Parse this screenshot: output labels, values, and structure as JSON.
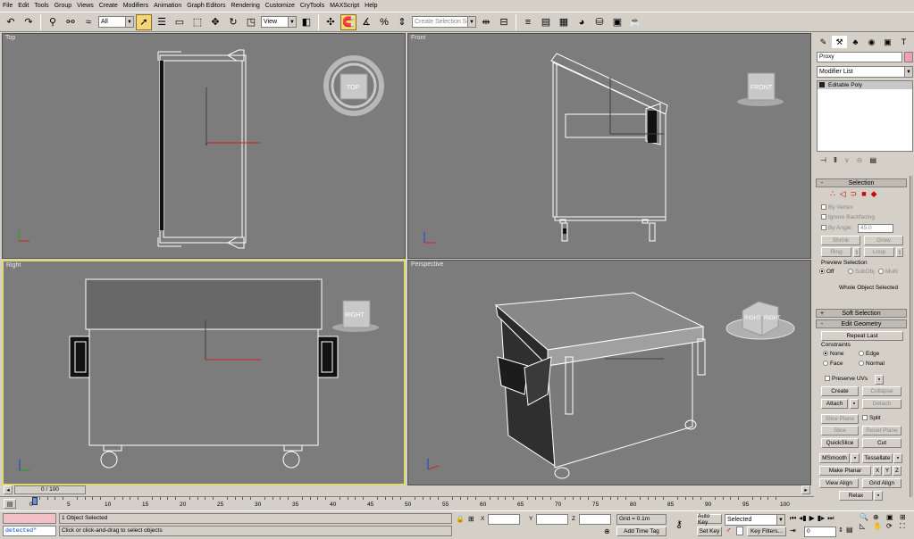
{
  "menu": [
    "File",
    "Edit",
    "Tools",
    "Group",
    "Views",
    "Create",
    "Modifiers",
    "Animation",
    "Graph Editors",
    "Rendering",
    "Customize",
    "CryTools",
    "MAXScript",
    "Help"
  ],
  "toolbar": {
    "filter_value": "All",
    "refcoord_value": "View",
    "selection_set_placeholder": "Create Selection Set"
  },
  "viewports": {
    "top": {
      "label": "Top",
      "cube_label": "TOP"
    },
    "front": {
      "label": "Front",
      "cube_label": "FRONT"
    },
    "right": {
      "label": "Right",
      "cube_label": "RIGHT"
    },
    "perspective": {
      "label": "Perspective",
      "cube_label_left": "RIGHT",
      "cube_label_right": "RIGHT"
    }
  },
  "cmd": {
    "object_name": "Proxy",
    "modifier_list": "Modifier List",
    "stack_item": "Editable Poly",
    "selection": {
      "title": "Selection",
      "by_vertex": "By Vertex",
      "ignore_backfacing": "Ignore Backfacing",
      "by_angle": "By Angle:",
      "angle_value": "45.0",
      "shrink": "Shrink",
      "grow": "Grow",
      "ring": "Ring",
      "loop": "Loop",
      "preview_title": "Preview Selection",
      "preview_off": "Off",
      "preview_subobj": "SubObj",
      "preview_multi": "Multi",
      "status": "Whole Object Selected"
    },
    "soft_selection": "Soft Selection",
    "edit_geometry": {
      "title": "Edit Geometry",
      "repeat_last": "Repeat Last",
      "constraints": "Constraints",
      "none": "None",
      "edge": "Edge",
      "face": "Face",
      "normal": "Normal",
      "preserve_uvs": "Preserve UVs",
      "create": "Create",
      "collapse": "Collapse",
      "attach": "Attach",
      "detach": "Detach",
      "slice_plane": "Slice Plane",
      "split": "Split",
      "slice": "Slice",
      "reset_plane": "Reset Plane",
      "quickslice": "QuickSlice",
      "cut": "Cut",
      "msmooth": "MSmooth",
      "tessellate": "Tessellate",
      "make_planar": "Make Planar",
      "x": "X",
      "y": "Y",
      "z": "Z",
      "view_align": "View Align",
      "grid_align": "Grid Align",
      "relax": "Relax"
    }
  },
  "timeline": {
    "frame_display": "0 / 100",
    "ticks": [
      "0",
      "5",
      "10",
      "15",
      "20",
      "25",
      "30",
      "35",
      "40",
      "45",
      "50",
      "55",
      "60",
      "65",
      "70",
      "75",
      "80",
      "85",
      "90",
      "95",
      "100"
    ]
  },
  "status": {
    "listener": "detected\"",
    "objects_selected": "1 Object Selected",
    "prompt": "Click or click-and-drag to select objects",
    "x_label": "X",
    "y_label": "Y",
    "z_label": "Z",
    "grid": "Grid = 0.1m",
    "add_time_tag": "Add Time Tag",
    "auto_key": "Auto Key",
    "selected_value": "Selected",
    "set_key": "Set Key",
    "key_filters": "Key Filters...",
    "current_frame": "0"
  }
}
